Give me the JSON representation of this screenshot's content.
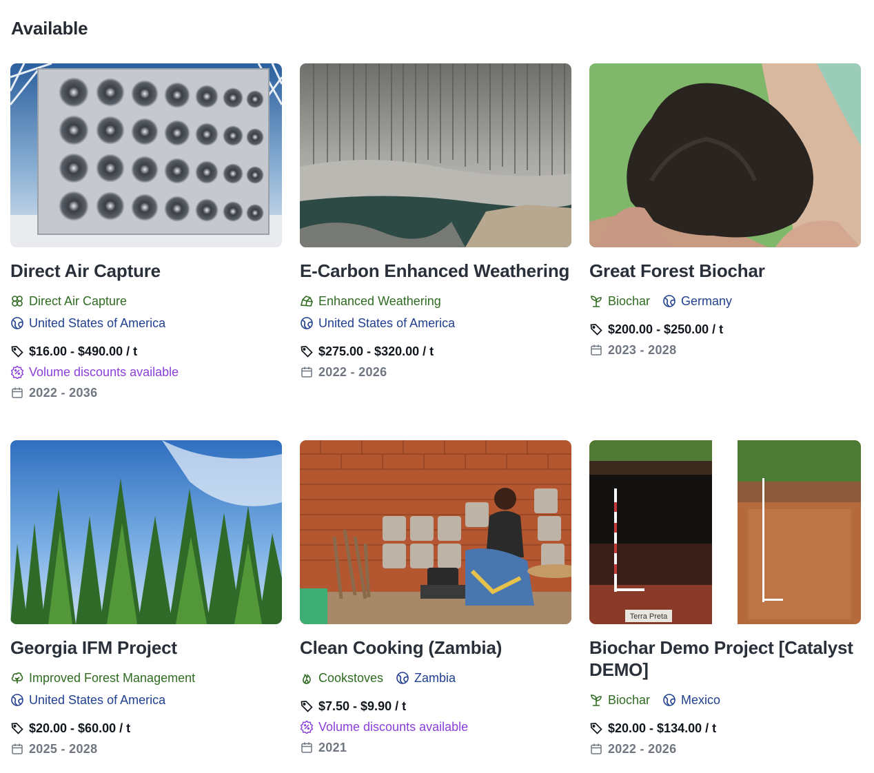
{
  "section": {
    "title": "Available"
  },
  "colors": {
    "type": "#2f6b21",
    "country": "#20408f",
    "discount": "#8a3fd9",
    "years": "#6f7680"
  },
  "projects": [
    {
      "title": "Direct Air Capture",
      "type": "Direct Air Capture",
      "type_icon": "clover-icon",
      "country": "United States of America",
      "price": "$16.00 - $490.00 / t",
      "discount": "Volume discounts available",
      "years": "2022 - 2036",
      "image": "direct-air-capture-fans-image"
    },
    {
      "title": "E-Carbon Enhanced Weathering",
      "type": "Enhanced Weathering",
      "type_icon": "rock-icon",
      "country": "United States of America",
      "price": "$275.00 - $320.00 / t",
      "discount": "",
      "years": "2022 - 2026",
      "image": "basalt-columns-image"
    },
    {
      "title": "Great Forest Biochar",
      "type": "Biochar",
      "type_icon": "sprout-icon",
      "country": "Germany",
      "price": "$200.00 - $250.00 / t",
      "discount": "",
      "years": "2023 - 2028",
      "image": "biochar-in-hand-image"
    },
    {
      "title": "Georgia IFM Project",
      "type": "Improved Forest Management",
      "type_icon": "tree-icon",
      "country": "United States of America",
      "price": "$20.00 - $60.00 / t",
      "discount": "",
      "years": "2025 - 2028",
      "image": "forest-canopy-image"
    },
    {
      "title": "Clean Cooking (Zambia)",
      "type": "Cookstoves",
      "type_icon": "flame-icon",
      "country": "Zambia",
      "price": "$7.50 - $9.90 / t",
      "discount": "Volume discounts available",
      "years": "2021",
      "image": "cookstoves-woman-image"
    },
    {
      "title": "Biochar Demo Project [Catalyst DEMO]",
      "type": "Biochar",
      "type_icon": "sprout-icon",
      "country": "Mexico",
      "price": "$20.00 - $134.00 / t",
      "discount": "",
      "years": "2022 - 2026",
      "image": "soil-profiles-image",
      "image_caption": "Terra Preta"
    }
  ]
}
